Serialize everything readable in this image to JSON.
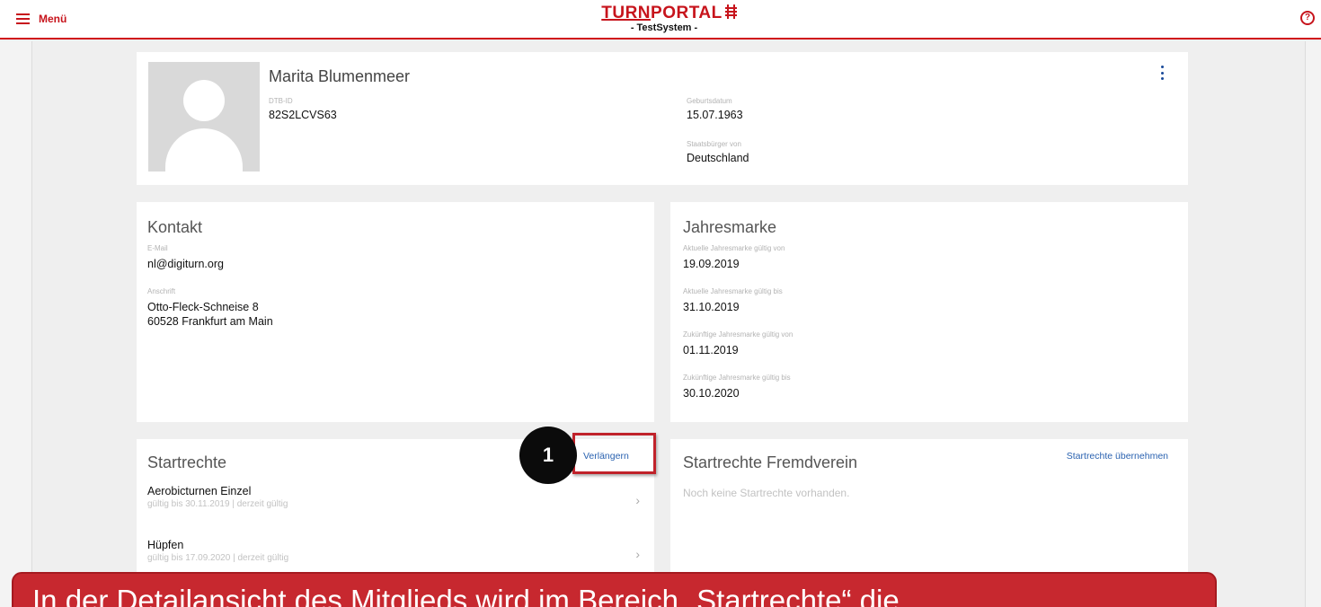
{
  "header": {
    "menu_label": "Menü",
    "logo_turn": "TURN",
    "logo_portal": "PORTAL",
    "logo_sub": "- TestSystem -",
    "help_glyph": "?"
  },
  "profile": {
    "name": "Marita Blumenmeer",
    "dtb_id_label": "DTB-ID",
    "dtb_id": "82S2LCVS63",
    "birth_label": "Geburtsdatum",
    "birth": "15.07.1963",
    "citizen_label": "Staatsbürger von",
    "citizen": "Deutschland"
  },
  "kontakt": {
    "title": "Kontakt",
    "email_label": "E-Mail",
    "email": "nl@digiturn.org",
    "address_label": "Anschrift",
    "street": "Otto-Fleck-Schneise 8",
    "city": "60528 Frankfurt am Main"
  },
  "jahresmarke": {
    "title": "Jahresmarke",
    "fields": [
      {
        "label": "Aktuelle Jahresmarke gültig von",
        "value": "19.09.2019"
      },
      {
        "label": "Aktuelle Jahresmarke gültig bis",
        "value": "31.10.2019"
      },
      {
        "label": "Zukünftige Jahresmarke gültig von",
        "value": "01.11.2019"
      },
      {
        "label": "Zukünftige Jahresmarke gültig bis",
        "value": "30.10.2020"
      }
    ]
  },
  "startrechte": {
    "title": "Startrechte",
    "action": "Verlängern",
    "items": [
      {
        "title": "Aerobicturnen Einzel",
        "sub": "gültig bis 30.11.2019 | derzeit gültig"
      },
      {
        "title": "Hüpfen",
        "sub": "gültig bis 17.09.2020 | derzeit gültig"
      }
    ]
  },
  "fremdverein": {
    "title": "Startrechte Fremdverein",
    "action": "Startrechte übernehmen",
    "empty": "Noch keine Startrechte vorhanden."
  },
  "annotation": {
    "number": "1",
    "caption": "In der Detailansicht des Mitglieds wird im Bereich „Startrechte“ die"
  },
  "colors": {
    "brand_red": "#c7141c",
    "link_blue": "#2a62b0",
    "banner_red": "#c7282f"
  },
  "icons": [
    "menu-icon",
    "help-icon",
    "more-vertical-icon",
    "avatar-placeholder-icon",
    "chevron-right-icon"
  ]
}
